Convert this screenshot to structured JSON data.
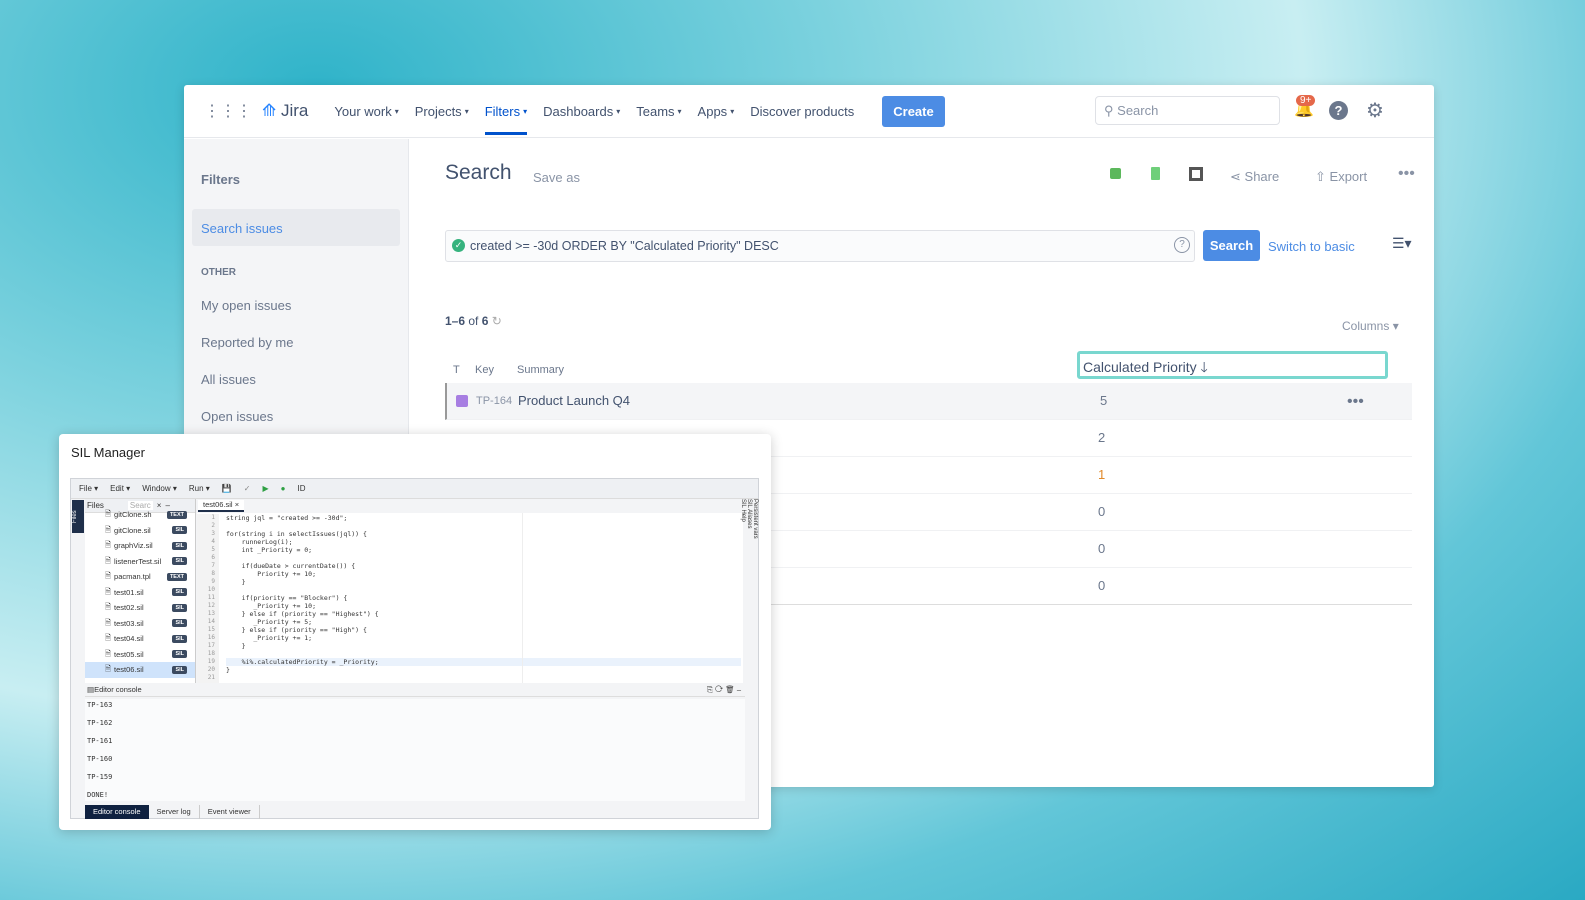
{
  "nav": {
    "logo": "Jira",
    "items": [
      "Your work",
      "Projects",
      "Filters",
      "Dashboards",
      "Teams",
      "Apps"
    ],
    "discover": "Discover products",
    "create": "Create",
    "search_placeholder": "Search",
    "notif_badge": "9+"
  },
  "sidebar": {
    "title": "Filters",
    "search_issues": "Search issues",
    "section": "OTHER",
    "items": [
      "My open issues",
      "Reported by me",
      "All issues",
      "Open issues"
    ]
  },
  "main": {
    "title": "Search",
    "save_as": "Save as",
    "share": "Share",
    "export": "Export",
    "jql": "created >= -30d ORDER BY \"Calculated Priority\" DESC",
    "search_btn": "Search",
    "switch": "Switch to basic",
    "count_prefix": "1–6",
    "count_of": "of",
    "count_total": "6",
    "columns": "Columns",
    "headers": {
      "t": "T",
      "key": "Key",
      "summary": "Summary",
      "calc": "Calculated Priority"
    },
    "rows": [
      {
        "key": "TP-164",
        "summary": "Product Launch Q4",
        "value": "5"
      },
      {
        "value": "2"
      },
      {
        "value": "1"
      },
      {
        "value": "0"
      },
      {
        "value": "0"
      },
      {
        "value": "0"
      }
    ]
  },
  "sil": {
    "title": "SIL Manager",
    "menu": [
      "File",
      "Edit",
      "Window",
      "Run"
    ],
    "files_tab": "Files",
    "search_placeholder": "Searc",
    "editor_tab": "test06.sil",
    "files": [
      {
        "name": "gitClone.sh",
        "type": "TEXT"
      },
      {
        "name": "gitClone.sil",
        "type": "SIL"
      },
      {
        "name": "graphViz.sil",
        "type": "SIL"
      },
      {
        "name": "listenerTest.sil",
        "type": "SIL"
      },
      {
        "name": "pacman.tpl",
        "type": "TEXT"
      },
      {
        "name": "test01.sil",
        "type": "SIL"
      },
      {
        "name": "test02.sil",
        "type": "SIL"
      },
      {
        "name": "test03.sil",
        "type": "SIL"
      },
      {
        "name": "test04.sil",
        "type": "SIL"
      },
      {
        "name": "test05.sil",
        "type": "SIL"
      },
      {
        "name": "test06.sil",
        "type": "SIL"
      }
    ],
    "code": [
      "string jql = \"created >= -30d\";",
      "",
      "for(string i in selectIssues(jql)) {",
      "    runnerLog(i);",
      "    int _Priority = 0;",
      "",
      "    if(dueDate > currentDate()) {",
      "        Priority += 10;",
      "    }",
      "",
      "    if(priority == \"Blocker\") {",
      "       _Priority += 10;",
      "    } else if (priority == \"Highest\") {",
      "       _Priority += 5;",
      "    } else if (priority == \"High\") {",
      "       _Priority += 1;",
      "    }",
      "",
      "    %i%.calculatedPriority = _Priority;",
      "}",
      ""
    ],
    "side_tabs": [
      "Persistent vars",
      "SIL Aliases",
      "SIL Help"
    ],
    "side_files": "Files",
    "console_title": "Editor console",
    "console": [
      "TP-163",
      "TP-162",
      "TP-161",
      "TP-160",
      "TP-159",
      "DONE!"
    ],
    "bottom_tabs": [
      "Editor console",
      "Server log",
      "Event viewer"
    ]
  },
  "colors": {
    "accent": "#4c8ce4",
    "highlight": "#79d7cf",
    "badge": "#e5684a"
  }
}
